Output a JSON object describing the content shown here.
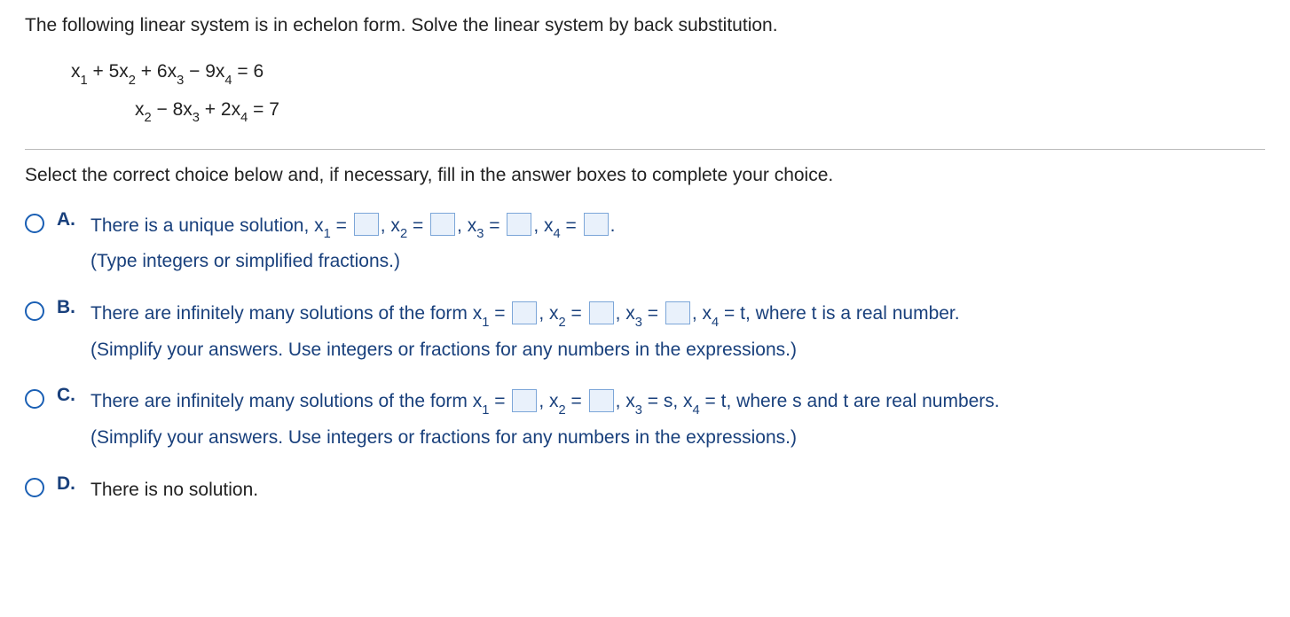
{
  "question": {
    "intro": "The following linear system is in echelon form. Solve the linear system by back substitution.",
    "eq1_lhs_1": "x",
    "eq1_lhs_2": " + 5x",
    "eq1_lhs_3": " + 6x",
    "eq1_lhs_4": " − 9x",
    "eq1_rhs": " = 6",
    "eq2_lhs_2": "x",
    "eq2_lhs_3": " − 8x",
    "eq2_lhs_4": " + 2x",
    "eq2_rhs": " = 7",
    "select_prompt": "Select the correct choice below and, if necessary, fill in the answer boxes to complete your choice."
  },
  "labels": {
    "A": "A.",
    "B": "B.",
    "C": "C.",
    "D": "D."
  },
  "choiceA": {
    "lead": "There is a unique solution,  x",
    "eq": " = ",
    "c_x2": ", x",
    "c_x3": ", x",
    "c_x4": ", x",
    "end": ".",
    "hint": "(Type integers or simplified fractions.)"
  },
  "choiceB": {
    "lead": "There are infinitely many solutions of the form x",
    "eq": " = ",
    "c_x2": ", x",
    "c_x3": ", x",
    "c_x4_tail": ", x",
    "tail_rest": " = t, where t is a real number.",
    "hint": "(Simplify your answers. Use integers or fractions for any numbers in the expressions.)"
  },
  "choiceC": {
    "lead": "There are infinitely many solutions of the form x",
    "eq": " = ",
    "c_x2": ", x",
    "c_x3_tail": ", x",
    "tail_rest": " = s, x",
    "tail_rest2": " = t, where s and t are real numbers.",
    "hint": "(Simplify your answers. Use integers or fractions for any numbers in the expressions.)"
  },
  "choiceD": {
    "text": "There is no solution."
  },
  "subs": {
    "s1": "1",
    "s2": "2",
    "s3": "3",
    "s4": "4"
  }
}
